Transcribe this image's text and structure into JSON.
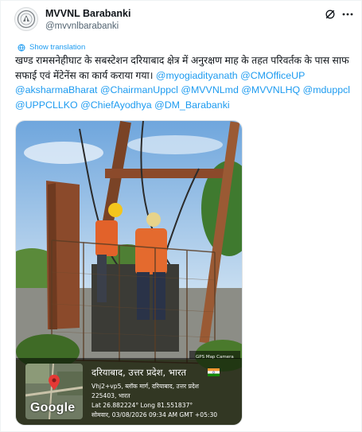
{
  "tweet": {
    "author_name": "MVVNL Barabanki",
    "author_handle": "@mvvnlbarabanki",
    "translate_label": "Show translation",
    "text_main": "खण्ड रामसनेहीघाट के सबस्टेशन दरियाबाद क्षेत्र में अनुरक्षण माह के तहत परिवर्तक के पास साफ सफाई एवं मेंटेनेंस का कार्य कराया गया।",
    "mentions": [
      "@myogiadityanath",
      "@CMOfficeUP",
      "@aksharmaBharat",
      "@ChairmanUppcl",
      "@MVVNLmd",
      "@MVVNLHQ",
      "@mduppcl",
      "@UPPCLLKO",
      "@ChiefAyodhya",
      "@DM_Barabanki"
    ]
  },
  "icons": {
    "avatar": "organization-logo-icon",
    "grok": "grok-icon",
    "more": "more-options-icon",
    "translate": "globe-icon"
  },
  "photo_overlay": {
    "app_label": "GPS Map Camera",
    "map_brand": "Google",
    "location_title": "दरियाबाद, उत्तर प्रदेश, भारत",
    "address_line1": "Vhj2+vp5, ब्लॉक मार्ग, दरियाबाद, उत्तर प्रदेश",
    "address_line2": "225403, भारत",
    "coordinates": "Lat 26.882224° Long 81.551837°",
    "datetime": "सोमवार, 03/08/2026 09:34 AM GMT +05:30"
  },
  "colors": {
    "link": "#1d9bf0",
    "text": "#0f1419",
    "secondary": "#536471"
  }
}
